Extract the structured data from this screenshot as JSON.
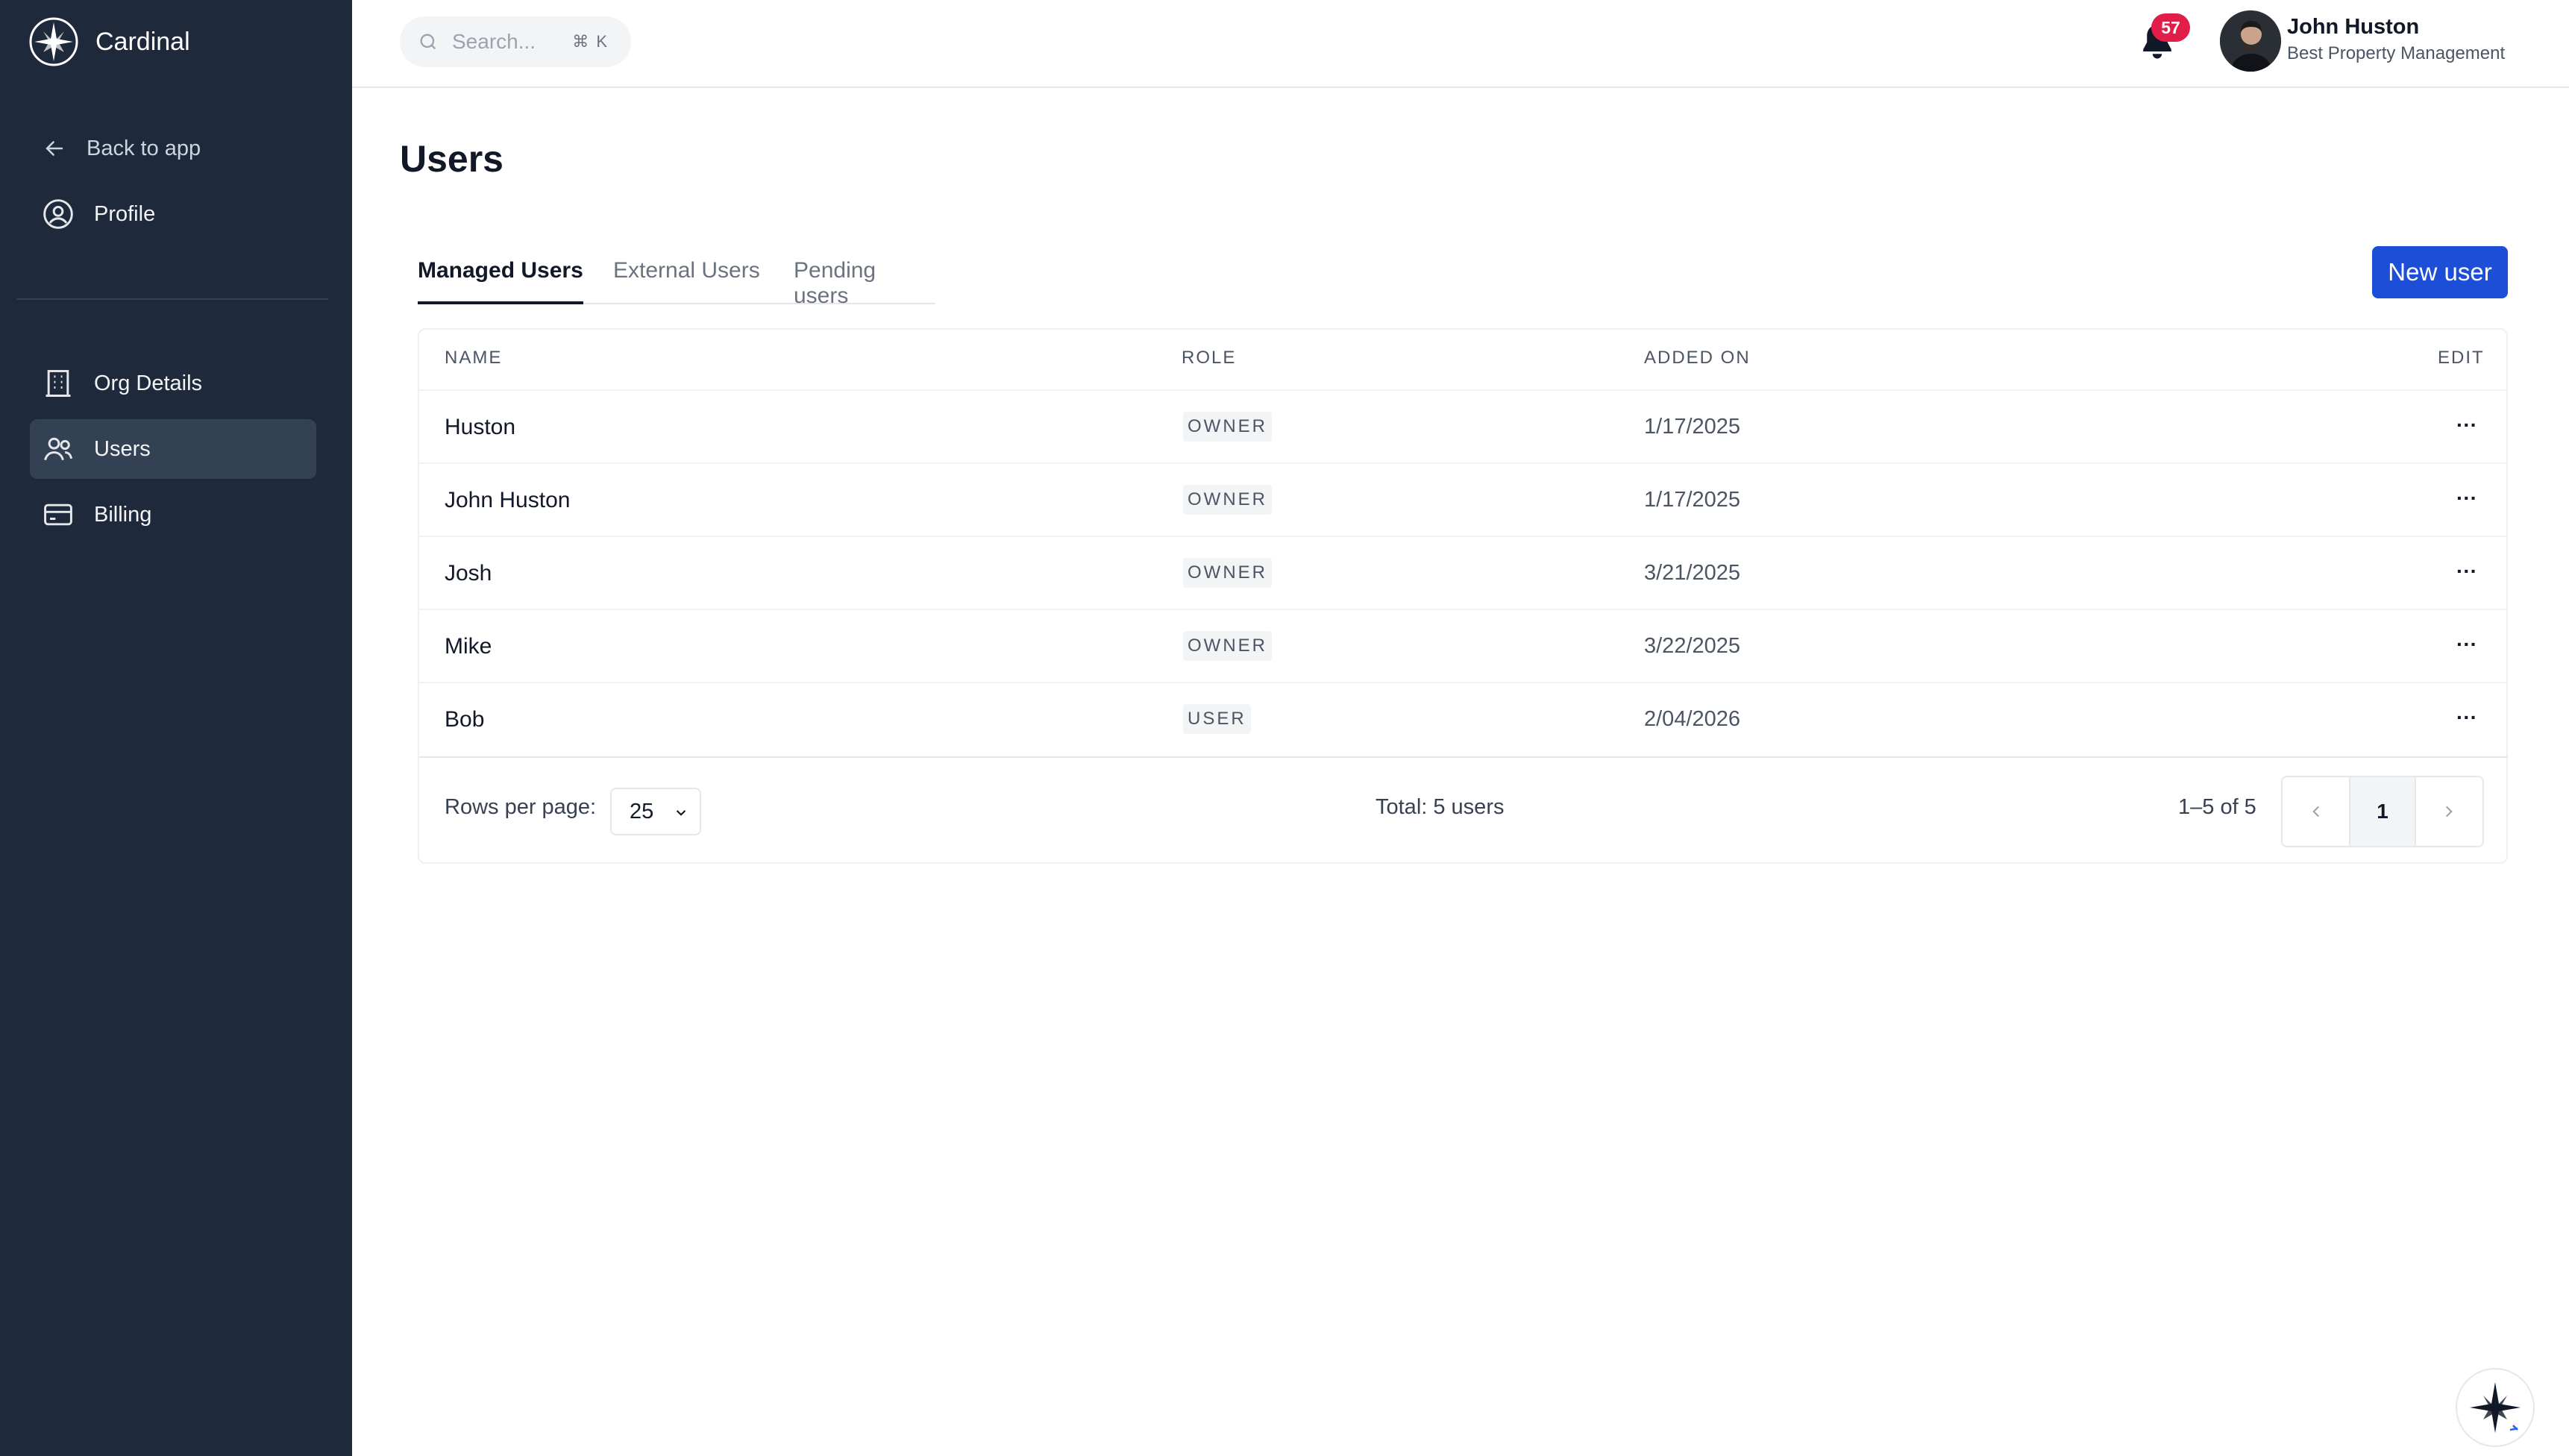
{
  "app": {
    "name": "Cardinal"
  },
  "sidebar": {
    "back_label": "Back to app",
    "profile_label": "Profile",
    "items": [
      {
        "label": "Org Details",
        "icon": "building-icon"
      },
      {
        "label": "Users",
        "icon": "users-icon",
        "active": true
      },
      {
        "label": "Billing",
        "icon": "credit-card-icon"
      }
    ]
  },
  "topbar": {
    "search_placeholder": "Search...",
    "search_shortcut": "⌘ K",
    "notification_count": "57",
    "user_name": "John Huston",
    "user_org": "Best Property Management"
  },
  "page": {
    "title": "Users",
    "tabs": [
      {
        "label": "Managed Users",
        "active": true
      },
      {
        "label": "External Users"
      },
      {
        "label": "Pending users"
      }
    ],
    "new_user_label": "New user"
  },
  "table": {
    "headers": {
      "name": "NAME",
      "role": "ROLE",
      "added_on": "ADDED ON",
      "edit": "EDIT"
    },
    "rows": [
      {
        "name": "Huston",
        "role": "OWNER",
        "added_on": "1/17/2025",
        "edit": "···"
      },
      {
        "name": "John Huston",
        "role": "OWNER",
        "added_on": "1/17/2025",
        "edit": "···"
      },
      {
        "name": "Josh",
        "role": "OWNER",
        "added_on": "3/21/2025",
        "edit": "···"
      },
      {
        "name": "Mike",
        "role": "OWNER",
        "added_on": "3/22/2025",
        "edit": "···"
      },
      {
        "name": "Bob",
        "role": "USER",
        "added_on": "2/04/2026",
        "edit": "···"
      }
    ],
    "footer": {
      "rows_per_page_label": "Rows per page:",
      "rows_per_page_value": "25",
      "total": "Total: 5 users",
      "range": "1–5 of 5",
      "current_page": "1"
    }
  },
  "colors": {
    "sidebar_bg": "#1e293b",
    "primary": "#1d4ed8",
    "badge": "#e11d48"
  }
}
